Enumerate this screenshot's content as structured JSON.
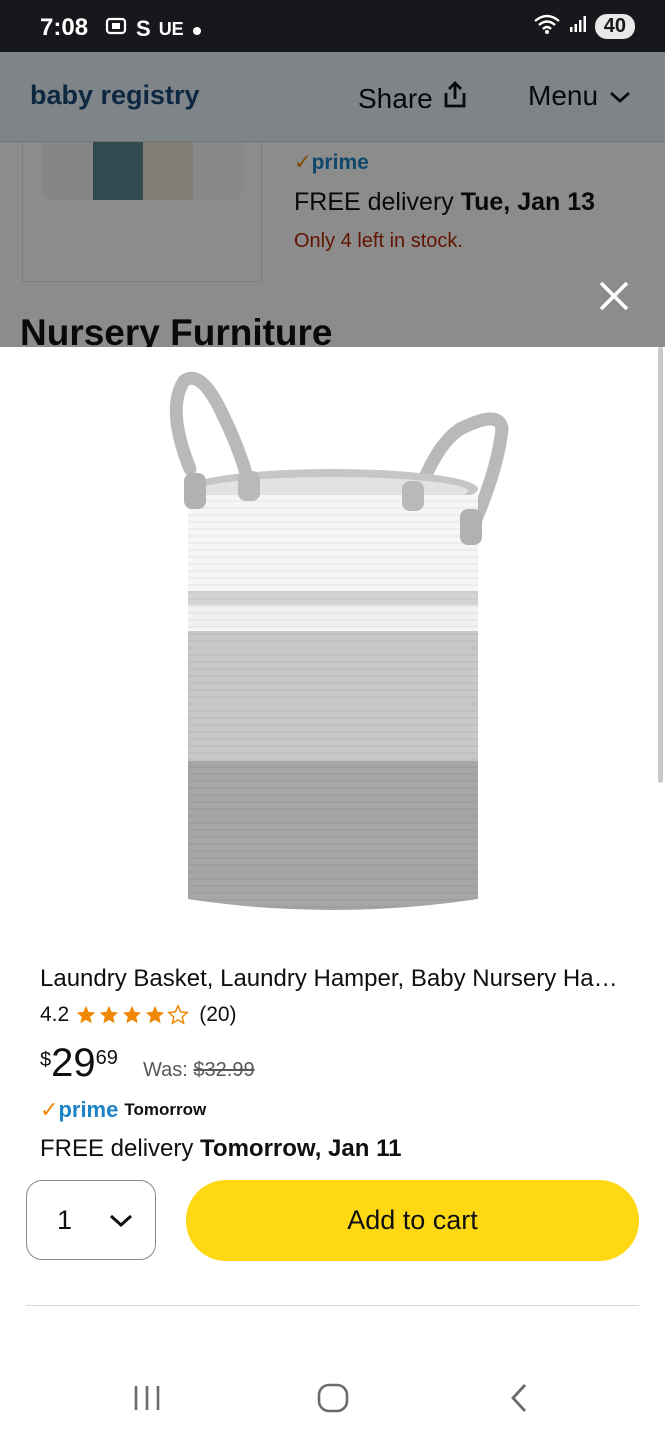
{
  "status_bar": {
    "time": "7:08",
    "carrier": "S",
    "ue": "UE",
    "battery": "40",
    "wifi_badge": "5"
  },
  "header": {
    "brand": "baby registry",
    "share_label": "Share",
    "menu_label": "Menu"
  },
  "background_item": {
    "prime": "prime",
    "delivery_prefix": "FREE delivery ",
    "delivery_date": "Tue, Jan 13",
    "stock": "Only 4 left in stock.",
    "section_heading": "Nursery Furniture"
  },
  "product": {
    "title": "Laundry Basket, Laundry Hamper, Baby Nursery Hamper",
    "rating": "4.2",
    "stars": 4.2,
    "review_count": "(20)",
    "price_currency": "$",
    "price_whole": "29",
    "price_fraction": "69",
    "was_label": "Was:",
    "was_price": "$32.99",
    "prime_label": "prime",
    "prime_when": "Tomorrow",
    "delivery_prefix": "FREE delivery ",
    "delivery_date": "Tomorrow, Jan 11"
  },
  "actions": {
    "quantity": "1",
    "add_to_cart": "Add to cart"
  },
  "colors": {
    "accent_yellow": "#ffd814",
    "prime_blue": "#1c83c6",
    "star_orange": "#f08804",
    "stock_red": "#b12704"
  }
}
